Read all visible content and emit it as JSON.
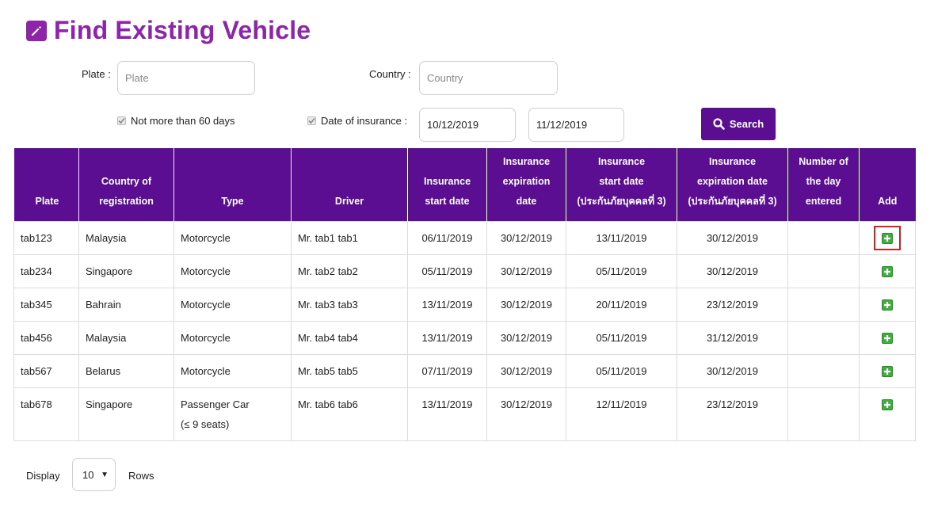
{
  "header": {
    "title": "Find Existing Vehicle",
    "icon": "edit-icon",
    "accent": "#8e24aa"
  },
  "filters": {
    "plate_label": "Plate :",
    "plate_placeholder": "Plate",
    "plate_value": "",
    "country_label": "Country :",
    "country_placeholder": "Country",
    "country_value": "",
    "not_more_60_label": "Not more than 60 days",
    "not_more_60_checked": true,
    "date_of_insurance_label": "Date of insurance :",
    "date_of_insurance_checked": true,
    "date_from": "10/12/2019",
    "date_to": "11/12/2019",
    "search_label": "Search"
  },
  "table": {
    "header_color": "#5b0e91",
    "columns": [
      "Plate",
      "Country of\nregistration",
      "Type",
      "Driver",
      "Insurance\nstart date",
      "Insurance\nexpiration\ndate",
      "Insurance\nstart date\n(ประกันภัยบุคคลที่ 3)",
      "Insurance\nexpiration date\n(ประกันภัยบุคคลที่ 3)",
      "Number of\nthe day\nentered",
      "Add"
    ],
    "rows": [
      {
        "plate": "tab123",
        "country": "Malaysia",
        "type": "Motorcycle",
        "type2": "",
        "driver": "Mr. tab1 tab1",
        "ins_start": "06/11/2019",
        "ins_exp": "30/12/2019",
        "tp_start": "13/11/2019",
        "tp_exp": "30/12/2019",
        "days": ""
      },
      {
        "plate": "tab234",
        "country": "Singapore",
        "type": "Motorcycle",
        "type2": "",
        "driver": "Mr. tab2 tab2",
        "ins_start": "05/11/2019",
        "ins_exp": "30/12/2019",
        "tp_start": "05/11/2019",
        "tp_exp": "30/12/2019",
        "days": ""
      },
      {
        "plate": "tab345",
        "country": "Bahrain",
        "type": "Motorcycle",
        "type2": "",
        "driver": "Mr. tab3 tab3",
        "ins_start": "13/11/2019",
        "ins_exp": "30/12/2019",
        "tp_start": "20/11/2019",
        "tp_exp": "23/12/2019",
        "days": ""
      },
      {
        "plate": "tab456",
        "country": "Malaysia",
        "type": "Motorcycle",
        "type2": "",
        "driver": "Mr. tab4 tab4",
        "ins_start": "13/11/2019",
        "ins_exp": "30/12/2019",
        "tp_start": "05/11/2019",
        "tp_exp": "31/12/2019",
        "days": ""
      },
      {
        "plate": "tab567",
        "country": "Belarus",
        "type": "Motorcycle",
        "type2": "",
        "driver": "Mr. tab5 tab5",
        "ins_start": "07/11/2019",
        "ins_exp": "30/12/2019",
        "tp_start": "05/11/2019",
        "tp_exp": "30/12/2019",
        "days": ""
      },
      {
        "plate": "tab678",
        "country": "Singapore",
        "type": "Passenger Car",
        "type2": "(≤ 9 seats)",
        "driver": "Mr. tab6 tab6",
        "ins_start": "13/11/2019",
        "ins_exp": "30/12/2019",
        "tp_start": "12/11/2019",
        "tp_exp": "23/12/2019",
        "days": ""
      }
    ],
    "add_icon": "plus-square-icon",
    "add_color": "#3fae3f",
    "highlight_color": "#d32020"
  },
  "footer": {
    "display_label": "Display",
    "rows_value": "10",
    "rows_label": "Rows"
  }
}
